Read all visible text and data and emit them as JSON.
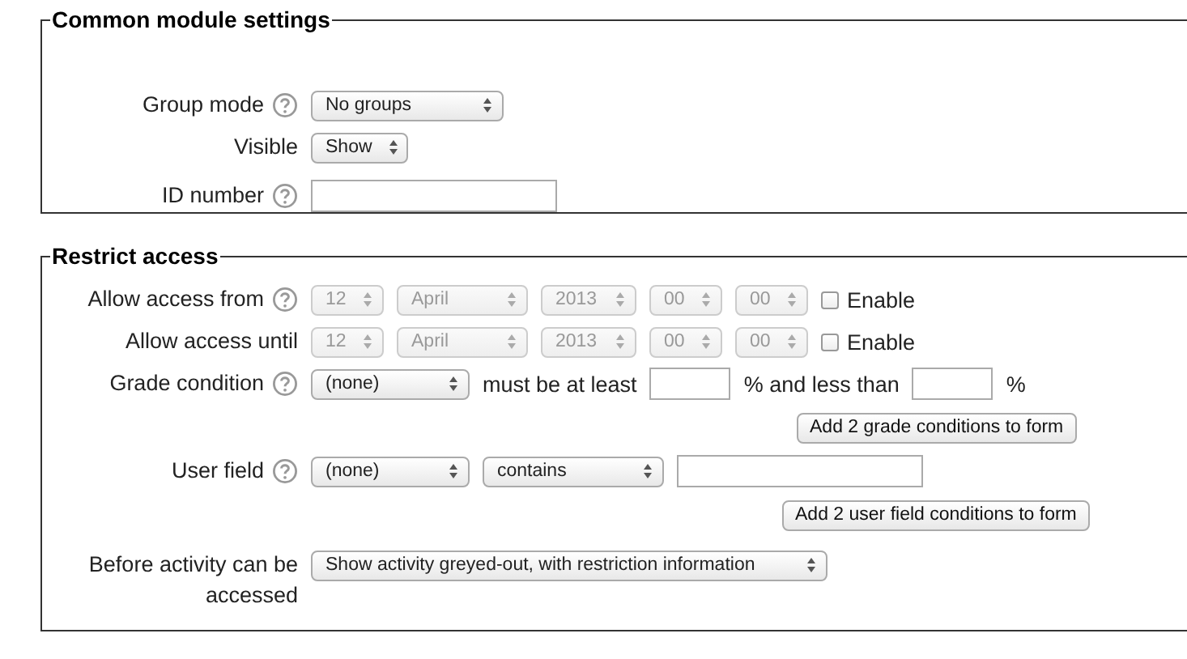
{
  "sections": [
    {
      "title": "Common module settings",
      "rows": [
        {
          "kind": "field",
          "label": "Group mode",
          "help": true,
          "controls": [
            {
              "kind": "select",
              "value": "No groups",
              "disabled": false
            }
          ]
        },
        {
          "kind": "field",
          "label": "Visible",
          "help": false,
          "controls": [
            {
              "kind": "select",
              "value": "Show",
              "disabled": false
            }
          ]
        },
        {
          "kind": "field",
          "label": "ID number",
          "help": true,
          "controls": [
            {
              "kind": "input"
            }
          ]
        }
      ]
    },
    {
      "title": "Restrict access",
      "rows": [
        {
          "kind": "field",
          "label": "Allow access from",
          "help": true,
          "controls": [
            {
              "kind": "select",
              "value": "12",
              "disabled": true
            },
            {
              "kind": "select",
              "value": "April",
              "disabled": true
            },
            {
              "kind": "select",
              "value": "2013",
              "disabled": true
            },
            {
              "kind": "select",
              "value": "00",
              "disabled": true
            },
            {
              "kind": "select",
              "value": "00",
              "disabled": true
            },
            {
              "kind": "checkbox",
              "label": "Enable",
              "checked": false
            }
          ]
        },
        {
          "kind": "field",
          "label": "Allow access until",
          "help": false,
          "controls": [
            {
              "kind": "select",
              "value": "12",
              "disabled": true
            },
            {
              "kind": "select",
              "value": "April",
              "disabled": true
            },
            {
              "kind": "select",
              "value": "2013",
              "disabled": true
            },
            {
              "kind": "select",
              "value": "00",
              "disabled": true
            },
            {
              "kind": "select",
              "value": "00",
              "disabled": true
            },
            {
              "kind": "checkbox",
              "label": "Enable",
              "checked": false
            }
          ]
        },
        {
          "kind": "field",
          "label": "Grade condition",
          "help": true,
          "controls": [
            {
              "kind": "select",
              "value": "(none)",
              "disabled": false
            },
            {
              "kind": "text",
              "text": "must be at least"
            },
            {
              "kind": "input"
            },
            {
              "kind": "text",
              "text": "% and less than"
            },
            {
              "kind": "input"
            },
            {
              "kind": "text",
              "text": "%"
            }
          ]
        },
        {
          "kind": "button",
          "label": "Add 2 grade conditions to form"
        },
        {
          "kind": "field",
          "label": "User field",
          "help": true,
          "controls": [
            {
              "kind": "select",
              "value": "(none)",
              "disabled": false
            },
            {
              "kind": "select",
              "value": "contains",
              "disabled": false
            },
            {
              "kind": "input"
            }
          ]
        },
        {
          "kind": "button",
          "label": "Add 2 user field conditions to form"
        },
        {
          "kind": "field",
          "label": "Before activity can be accessed",
          "help": false,
          "controls": [
            {
              "kind": "select",
              "value": "Show activity greyed-out, with restriction information",
              "disabled": false
            }
          ]
        }
      ]
    }
  ]
}
